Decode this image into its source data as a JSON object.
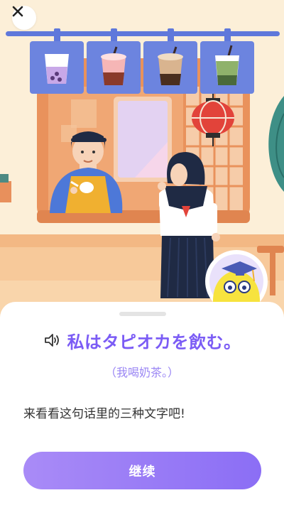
{
  "close": {
    "icon": "close-icon"
  },
  "lesson": {
    "sentence": "私はタピオカを飲む。",
    "translation": "（我喝奶茶。）",
    "prompt": "来看看这句话里的三种文字吧!",
    "audio_icon": "speaker-icon"
  },
  "actions": {
    "continue_label": "继续"
  },
  "colors": {
    "accent": "#7b5cf5",
    "translation": "#9a86f4",
    "menu_card": "#6c84df",
    "shop_frame": "#e9925c",
    "background": "#fbefd9"
  }
}
